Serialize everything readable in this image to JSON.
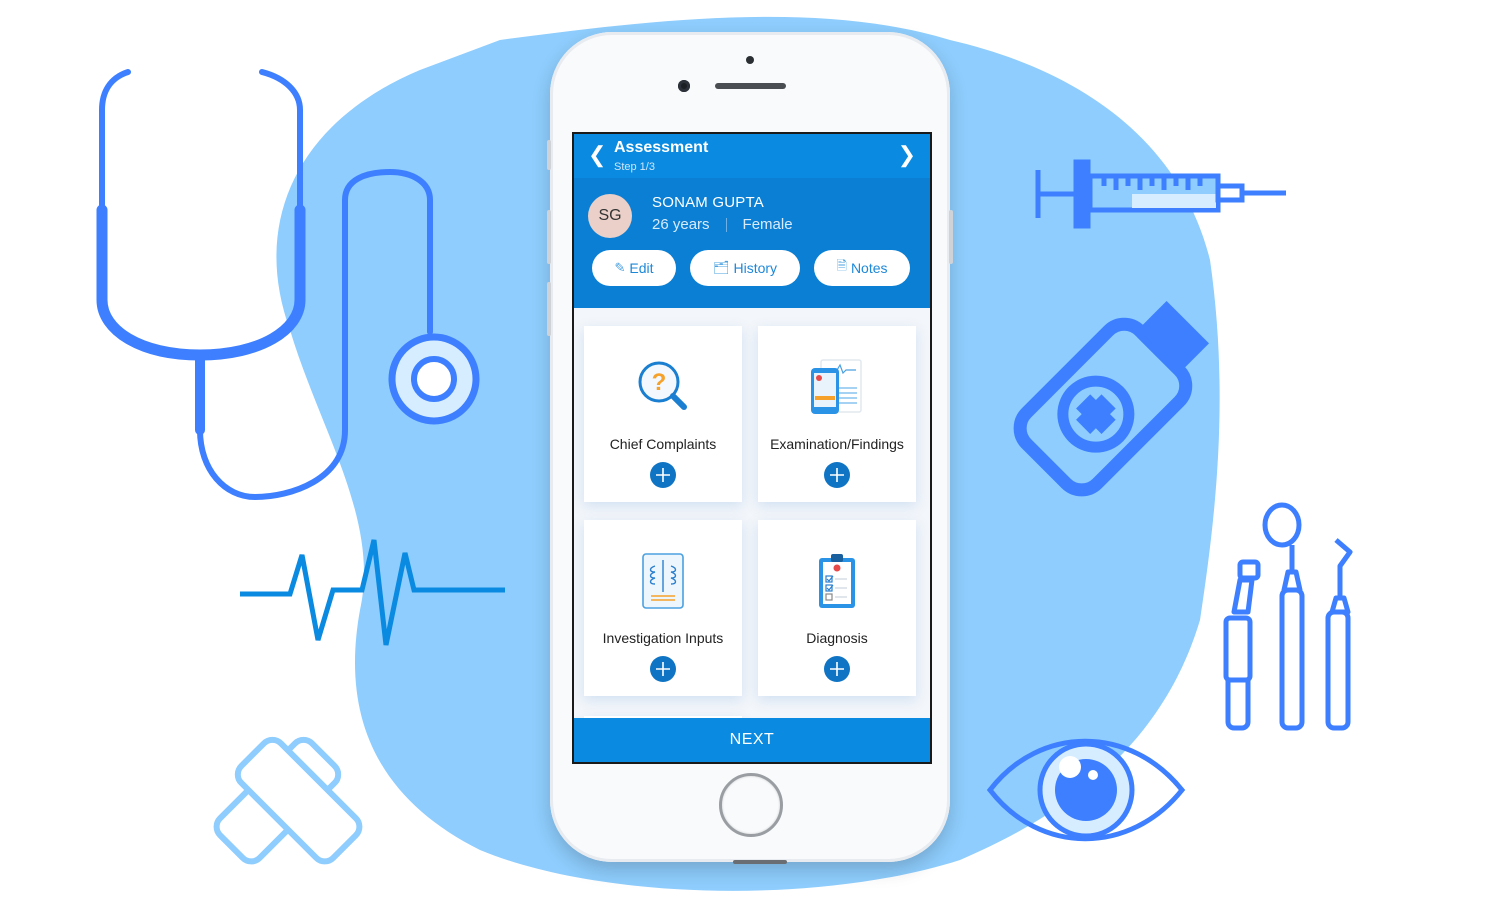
{
  "app": {
    "header": {
      "title": "Assessment",
      "step": "Step 1/3",
      "back_icon": "chevron-left-icon",
      "forward_icon": "chevron-right-icon"
    },
    "patient": {
      "initials": "SG",
      "name": "SONAM GUPTA",
      "age": "26 years",
      "gender": "Female"
    },
    "actions": [
      {
        "label": "Edit",
        "icon": "pencil-icon"
      },
      {
        "label": "History",
        "icon": "medical-folder-icon"
      },
      {
        "label": "Notes",
        "icon": "document-icon"
      }
    ],
    "cards": [
      {
        "label": "Chief Complaints",
        "icon": "question-magnifier-icon"
      },
      {
        "label": "Examination/Findings",
        "icon": "medical-report-icon"
      },
      {
        "label": "Investigation Inputs",
        "icon": "xray-icon"
      },
      {
        "label": "Diagnosis",
        "icon": "clipboard-checklist-icon"
      }
    ],
    "next_label": "NEXT"
  },
  "colors": {
    "primary": "#0a8ae0",
    "primary_dark": "#0a7fd4",
    "plus_button": "#0f74c4",
    "illustration_blue": "#3d7fff",
    "blob": "#8ecdfd"
  },
  "decorations": [
    "stethoscope-icon",
    "heartbeat-icon",
    "bandage-icon",
    "syringe-icon",
    "medicine-bottle-icon",
    "dental-tools-icon",
    "eye-icon"
  ]
}
